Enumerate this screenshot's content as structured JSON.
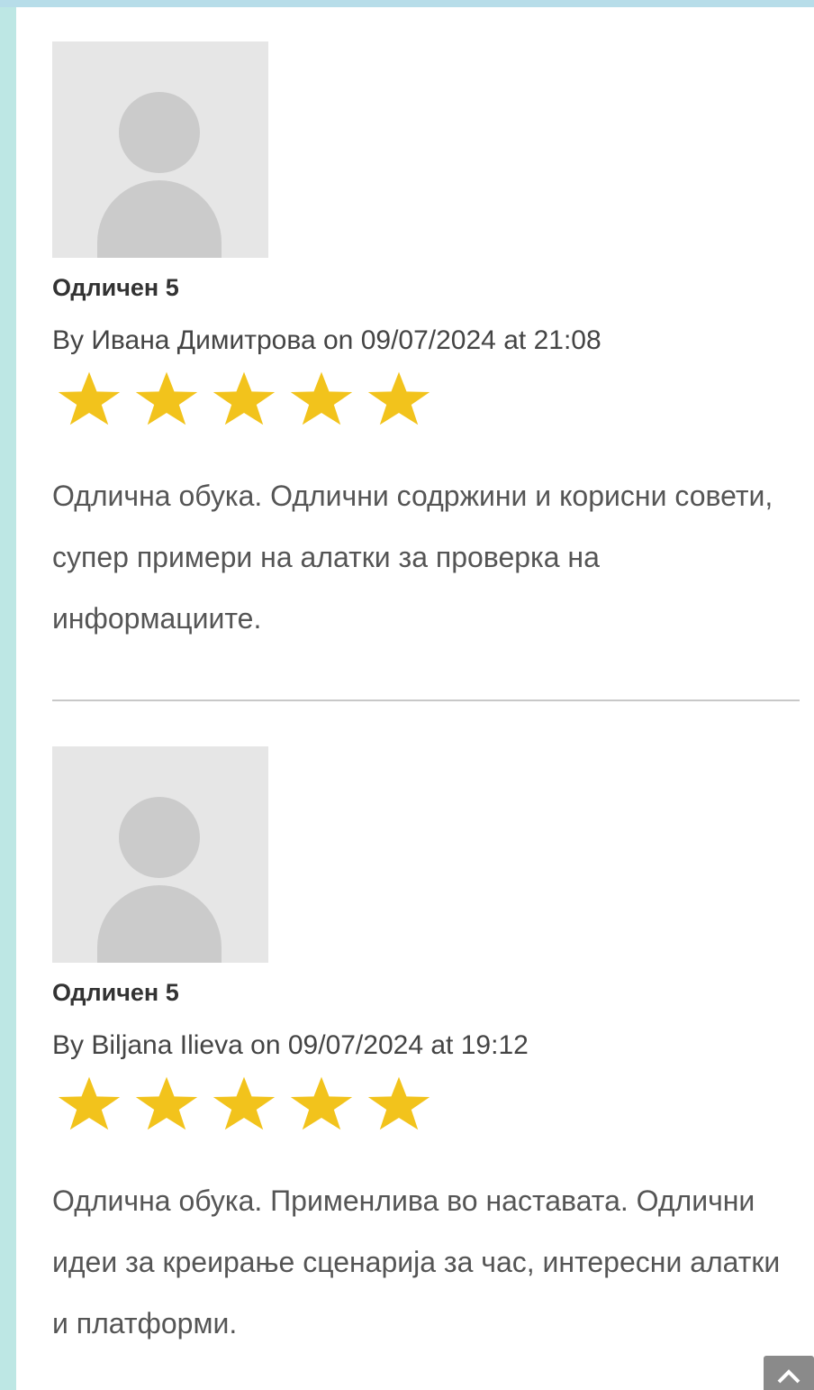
{
  "reviews": [
    {
      "title": "Одличен 5",
      "meta_prefix": "By",
      "author": "Ивана Димитрова",
      "meta_on": "on",
      "date": "09/07/2024",
      "meta_at": "at",
      "time": "21:08",
      "rating": 5,
      "rating_max": 5,
      "text": "Одлична обука. Одлични содржини и корисни совети, супер примери на алатки за проверка на информациите."
    },
    {
      "title": "Одличен 5",
      "meta_prefix": "By",
      "author": "Biljana Ilieva",
      "meta_on": "on",
      "date": "09/07/2024",
      "meta_at": "at",
      "time": "19:12",
      "rating": 5,
      "rating_max": 5,
      "text": "Одлична обука. Применлива во наставата. Одлични идеи за креирање сценарија за час, интересни алатки и платформи."
    }
  ],
  "colors": {
    "star": "#f2c31c",
    "avatar_bg": "#e6e6e6",
    "avatar_fg": "#cbcbcb",
    "page_border": "#bde7e4"
  },
  "icons": {
    "avatar": "default-user-avatar-icon",
    "star": "star-icon",
    "scroll_top": "chevron-up-icon"
  }
}
